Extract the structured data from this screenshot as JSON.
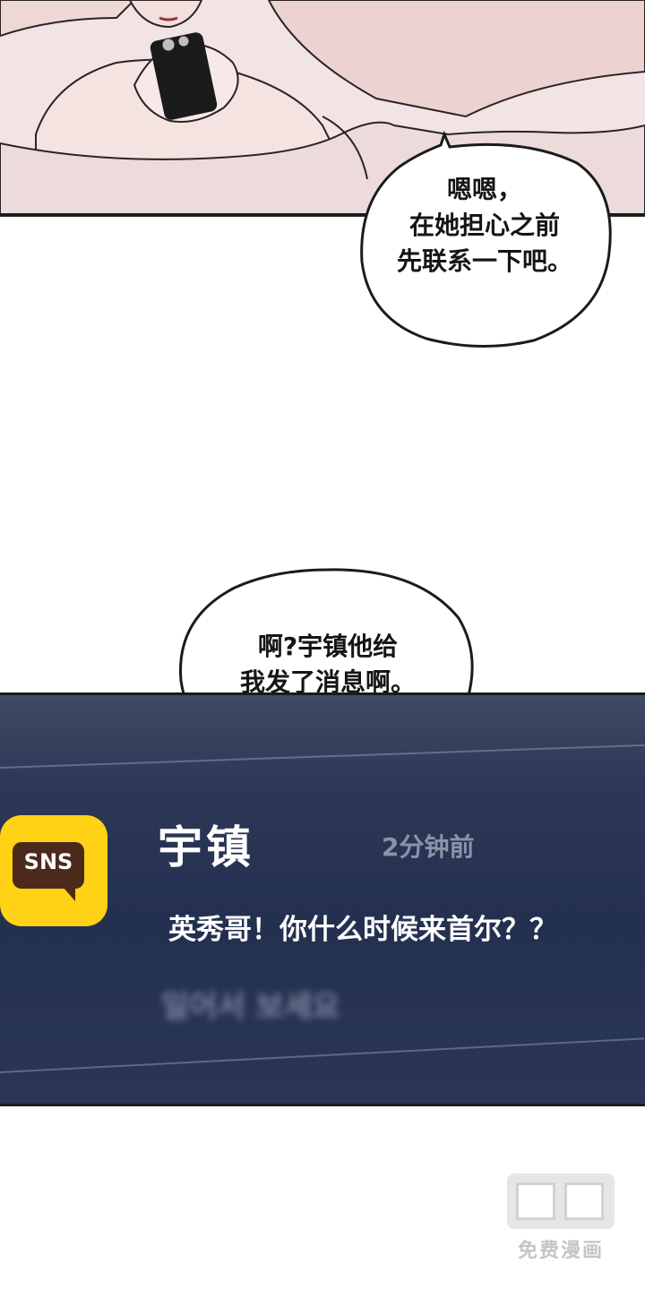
{
  "bubbles": {
    "top": "嗯嗯，\n在她担心之前\n先联系一下吧。",
    "middle": "啊?宇镇他给\n我发了消息啊。"
  },
  "notification": {
    "app_icon_label": "SNS",
    "app_icon_name": "sns-chat-icon",
    "sender": "宇镇",
    "time": "2分钟前",
    "message": "英秀哥！你什么时候来首尔？？",
    "blurred_hint": "일어서 보세요",
    "accent_color": "#ffd215"
  },
  "watermark": {
    "text": "免费漫画"
  }
}
